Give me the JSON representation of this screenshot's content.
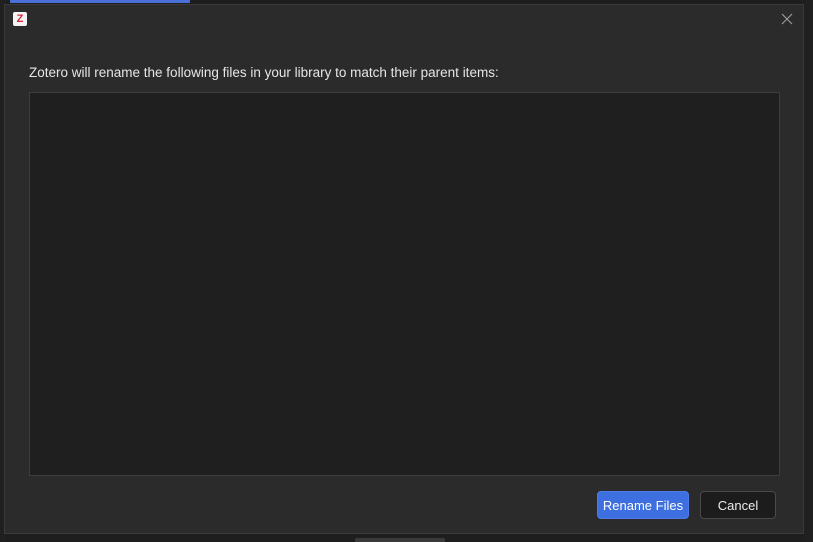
{
  "window": {
    "app_icon": "zotero-icon",
    "app_icon_letter": "Z",
    "close_icon": "close-icon"
  },
  "dialog": {
    "message": "Zotero will rename the following files in your library to match their parent items:",
    "files": []
  },
  "buttons": {
    "rename_label": "Rename Files",
    "cancel_label": "Cancel"
  },
  "colors": {
    "primary": "#3e6fe0",
    "dialog_bg": "#2b2b2b",
    "list_bg": "#1f1f1f"
  }
}
